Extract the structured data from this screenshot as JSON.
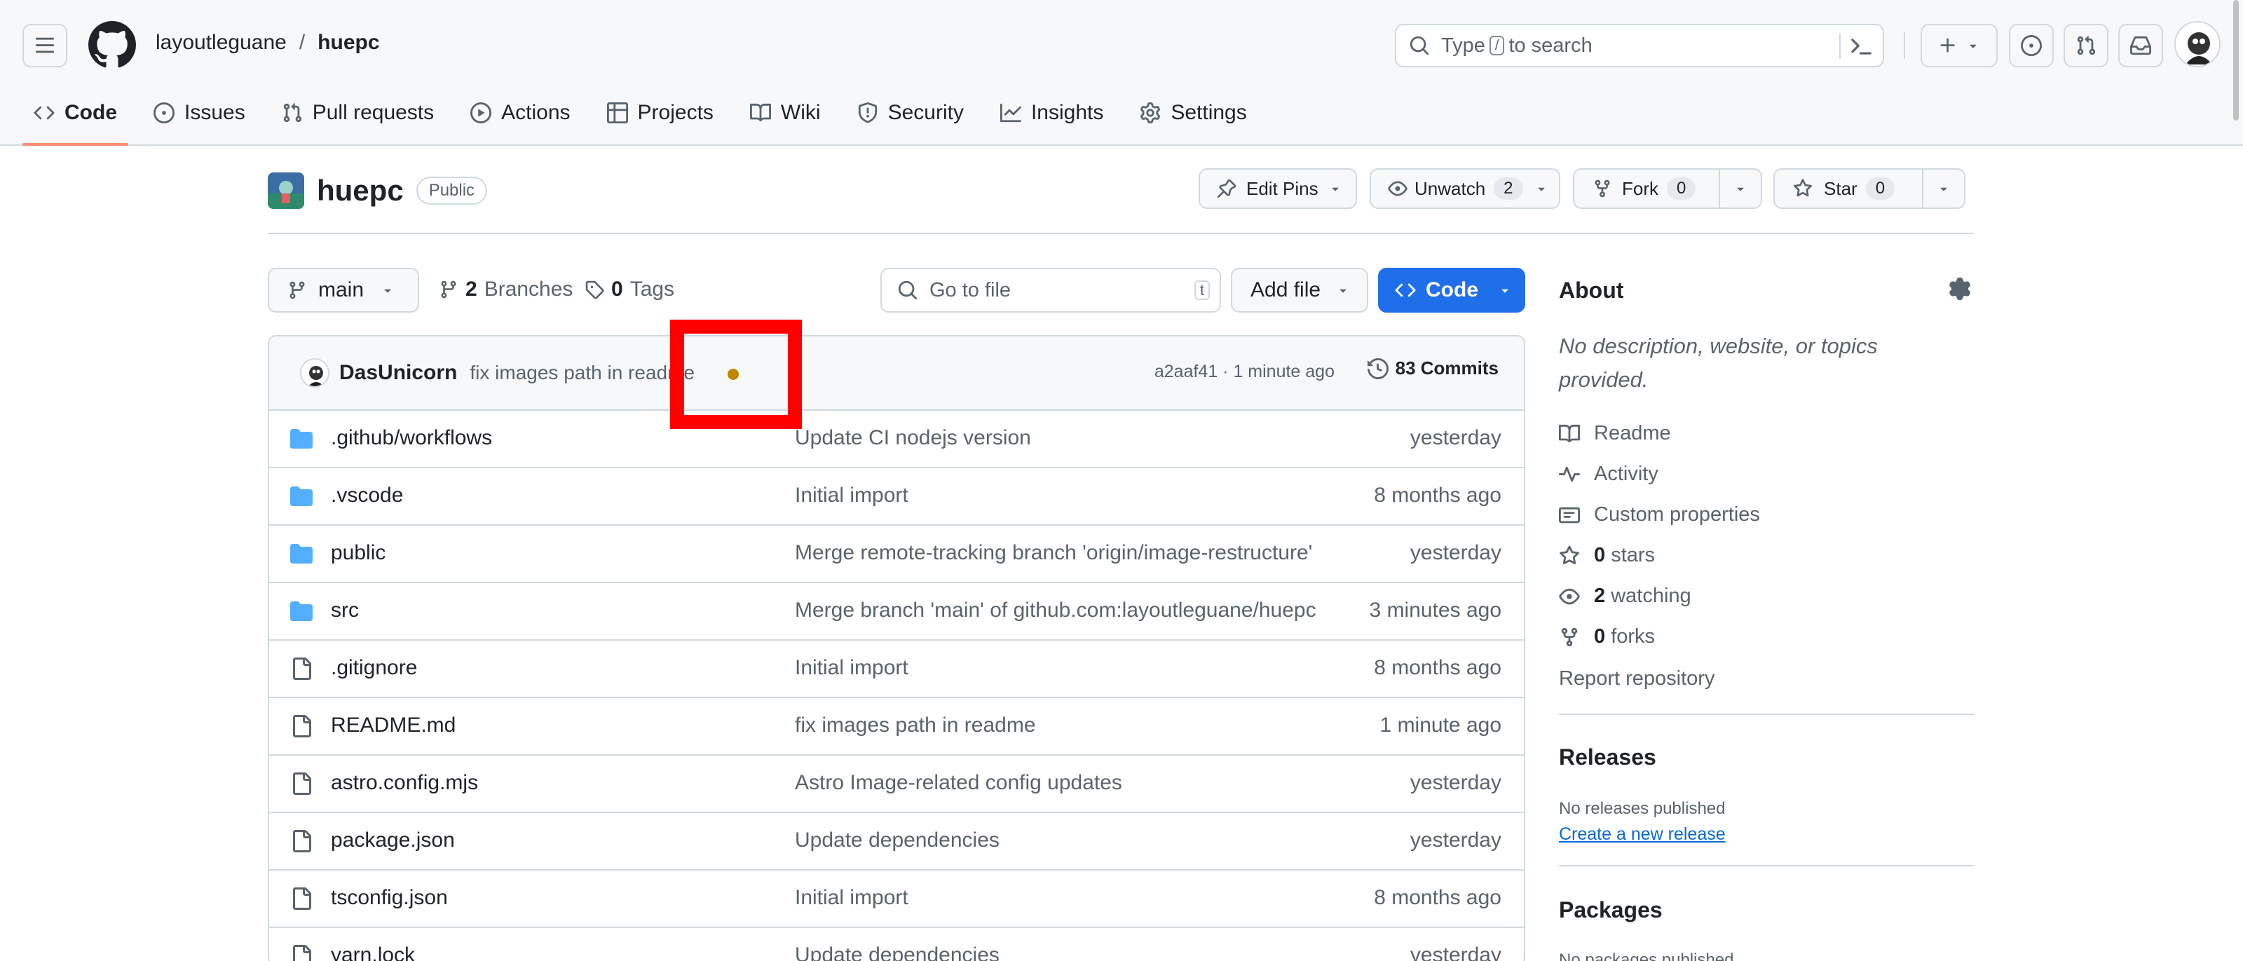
{
  "header": {
    "owner": "layoutleguane",
    "separator": "/",
    "repo": "huepc",
    "search_prefix": "Type",
    "search_key": "/",
    "search_suffix": "to search"
  },
  "repo_nav": [
    {
      "label": "Code",
      "icon": "code-icon",
      "active": true
    },
    {
      "label": "Issues",
      "icon": "issue-icon"
    },
    {
      "label": "Pull requests",
      "icon": "pull-request-icon"
    },
    {
      "label": "Actions",
      "icon": "play-icon"
    },
    {
      "label": "Projects",
      "icon": "table-icon"
    },
    {
      "label": "Wiki",
      "icon": "book-icon"
    },
    {
      "label": "Security",
      "icon": "shield-icon"
    },
    {
      "label": "Insights",
      "icon": "graph-icon"
    },
    {
      "label": "Settings",
      "icon": "gear-icon"
    }
  ],
  "repo": {
    "name": "huepc",
    "visibility": "Public",
    "edit_pins": "Edit Pins",
    "unwatch": "Unwatch",
    "watch_count": "2",
    "fork": "Fork",
    "fork_count": "0",
    "star": "Star",
    "star_count": "0"
  },
  "toolbar": {
    "branch": "main",
    "branches_count": "2",
    "branches_label": "Branches",
    "tags_count": "0",
    "tags_label": "Tags",
    "go_to_file": "Go to file",
    "go_to_file_key": "t",
    "add_file": "Add file",
    "code": "Code"
  },
  "latest_commit": {
    "author": "DasUnicorn",
    "message": "fix images path in readme",
    "meta": "a2aaf41 · 1 minute ago",
    "commits": "83 Commits"
  },
  "files": [
    {
      "name": ".github/workflows",
      "type": "folder",
      "message": "Update CI nodejs version",
      "date": "yesterday"
    },
    {
      "name": ".vscode",
      "type": "folder",
      "message": "Initial import",
      "date": "8 months ago"
    },
    {
      "name": "public",
      "type": "folder",
      "message": "Merge remote-tracking branch 'origin/image-restructure'",
      "date": "yesterday"
    },
    {
      "name": "src",
      "type": "folder",
      "message": "Merge branch 'main' of github.com:layoutleguane/huepc",
      "date": "3 minutes ago"
    },
    {
      "name": ".gitignore",
      "type": "file",
      "message": "Initial import",
      "date": "8 months ago"
    },
    {
      "name": "README.md",
      "type": "file",
      "message": "fix images path in readme",
      "date": "1 minute ago"
    },
    {
      "name": "astro.config.mjs",
      "type": "file",
      "message": "Astro Image-related config updates",
      "date": "yesterday"
    },
    {
      "name": "package.json",
      "type": "file",
      "message": "Update dependencies",
      "date": "yesterday"
    },
    {
      "name": "tsconfig.json",
      "type": "file",
      "message": "Initial import",
      "date": "8 months ago"
    },
    {
      "name": "yarn.lock",
      "type": "file",
      "message": "Update dependencies",
      "date": "yesterday"
    }
  ],
  "sidebar": {
    "about": "About",
    "description": "No description, website, or topics provided.",
    "readme": "Readme",
    "activity": "Activity",
    "custom_properties": "Custom properties",
    "stars_count": "0",
    "stars_label": "stars",
    "watching_count": "2",
    "watching_label": "watching",
    "forks_count": "0",
    "forks_label": "forks",
    "report": "Report repository",
    "releases": "Releases",
    "no_releases": "No releases published",
    "create_release": "Create a new release",
    "packages": "Packages",
    "no_packages": "No packages published"
  },
  "colors": {
    "accent_blue": "#1f6feb",
    "active_tab_underline": "#fd8c73",
    "folder_blue": "#54aeff",
    "status_dot": "#bf8700",
    "highlight_box": "#ff0000"
  }
}
